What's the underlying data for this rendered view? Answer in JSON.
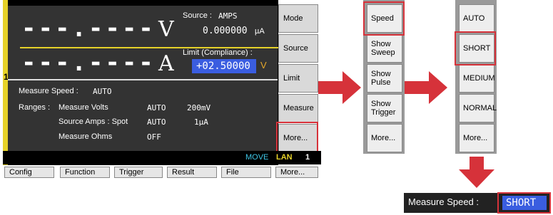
{
  "display": {
    "channel_number": "1",
    "voltage_reading": "---.----",
    "voltage_unit": "V",
    "current_reading": "---.----",
    "current_unit": "A",
    "source_label": "Source :",
    "source_mode": "AMPS",
    "source_value": "0.000000",
    "source_unit": "µA",
    "limit_label": "Limit (Compliance) :",
    "limit_value": "+02.50000",
    "limit_unit": "V",
    "measure_speed_label": "Measure Speed :",
    "measure_speed_value": "AUTO",
    "ranges_label": "Ranges :",
    "ranges": [
      {
        "name": "Measure Volts",
        "mode": "AUTO",
        "value": "200mV"
      },
      {
        "name": "Source Amps : Spot",
        "mode": "AUTO",
        "value": "1µA"
      },
      {
        "name": "Measure Ohms",
        "mode": "OFF",
        "value": ""
      }
    ]
  },
  "status_bar": {
    "move": "MOVE",
    "lan": "LAN",
    "channel": "1"
  },
  "softkeys": [
    "Mode",
    "Source",
    "Limit",
    "Measure",
    "More..."
  ],
  "function_keys": [
    "Config",
    "Function",
    "Trigger",
    "Result",
    "File",
    "More..."
  ],
  "menu2": [
    "Speed",
    "Show Sweep",
    "Show Pulse",
    "Show Trigger",
    "More..."
  ],
  "menu3": [
    "AUTO",
    "SHORT",
    "MEDIUM",
    "NORMAL",
    "More..."
  ],
  "result": {
    "label": "Measure Speed :",
    "value": "SHORT"
  },
  "colors": {
    "accent_red": "#d6323a",
    "highlight_blue": "#3a5de0",
    "yellow": "#e6d229"
  }
}
